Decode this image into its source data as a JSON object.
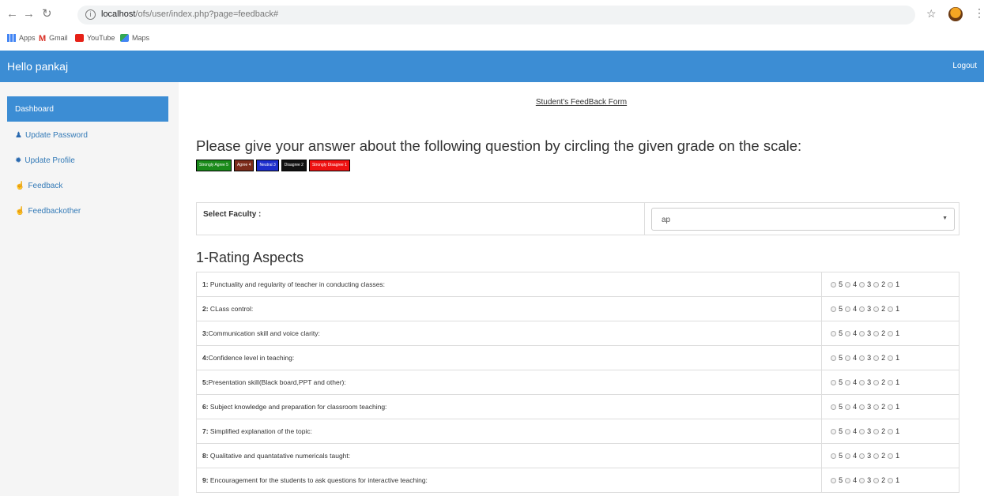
{
  "browser": {
    "url_host": "localhost",
    "url_path": "/ofs/user/index.php?page=feedback#",
    "bookmarks": [
      "Apps",
      "Gmail",
      "YouTube",
      "Maps"
    ]
  },
  "header": {
    "brand": "Hello pankaj",
    "logout": "Logout"
  },
  "sidebar": {
    "items": [
      {
        "label": "Dashboard",
        "icon": "",
        "active": true
      },
      {
        "label": "Update Password",
        "icon": "user-icon",
        "active": false
      },
      {
        "label": "Update Profile",
        "icon": "gear-icon",
        "active": false
      },
      {
        "label": "Feedback",
        "icon": "thumbs-up-icon",
        "active": false
      },
      {
        "label": "Feedbackother",
        "icon": "thumbs-up-icon",
        "active": false
      }
    ]
  },
  "main": {
    "form_title": "Student's FeedBack Form",
    "instructions": "Please give your answer about the following question by circling the given grade on the scale:",
    "legend": [
      {
        "label": "Strongly Agree 5",
        "color": "#1a8a1a"
      },
      {
        "label": "Agree 4",
        "color": "#7b2b1a"
      },
      {
        "label": "Neutral 3",
        "color": "#1d2ecc"
      },
      {
        "label": "Disagree 2",
        "color": "#111111"
      },
      {
        "label": "Strongly Disagree 1",
        "color": "#ee1111"
      }
    ],
    "faculty": {
      "label": "Select Faculty :",
      "value": "ap"
    },
    "section_heading": "1-Rating Aspects",
    "questions": [
      {
        "num": "1:",
        "text": " Punctuality and regularity of teacher in conducting classes:"
      },
      {
        "num": "2:",
        "text": " CLass control:"
      },
      {
        "num": "3:",
        "text": "Communication skill and voice clarity:"
      },
      {
        "num": "4:",
        "text": "Confidence level in teaching:"
      },
      {
        "num": "5:",
        "text": "Presentation skill(Black board,PPT and other):"
      },
      {
        "num": "6:",
        "text": " Subject knowledge and preparation for classroom teaching:"
      },
      {
        "num": "7:",
        "text": " Simplified explanation of the topic:"
      },
      {
        "num": "8:",
        "text": " Qualitative and quantatative numericals taught:"
      },
      {
        "num": "9:",
        "text": " Encouragement for the students to ask questions for interactive teaching:"
      }
    ],
    "rating_options": [
      "5",
      "4",
      "3",
      "2",
      "1"
    ]
  }
}
